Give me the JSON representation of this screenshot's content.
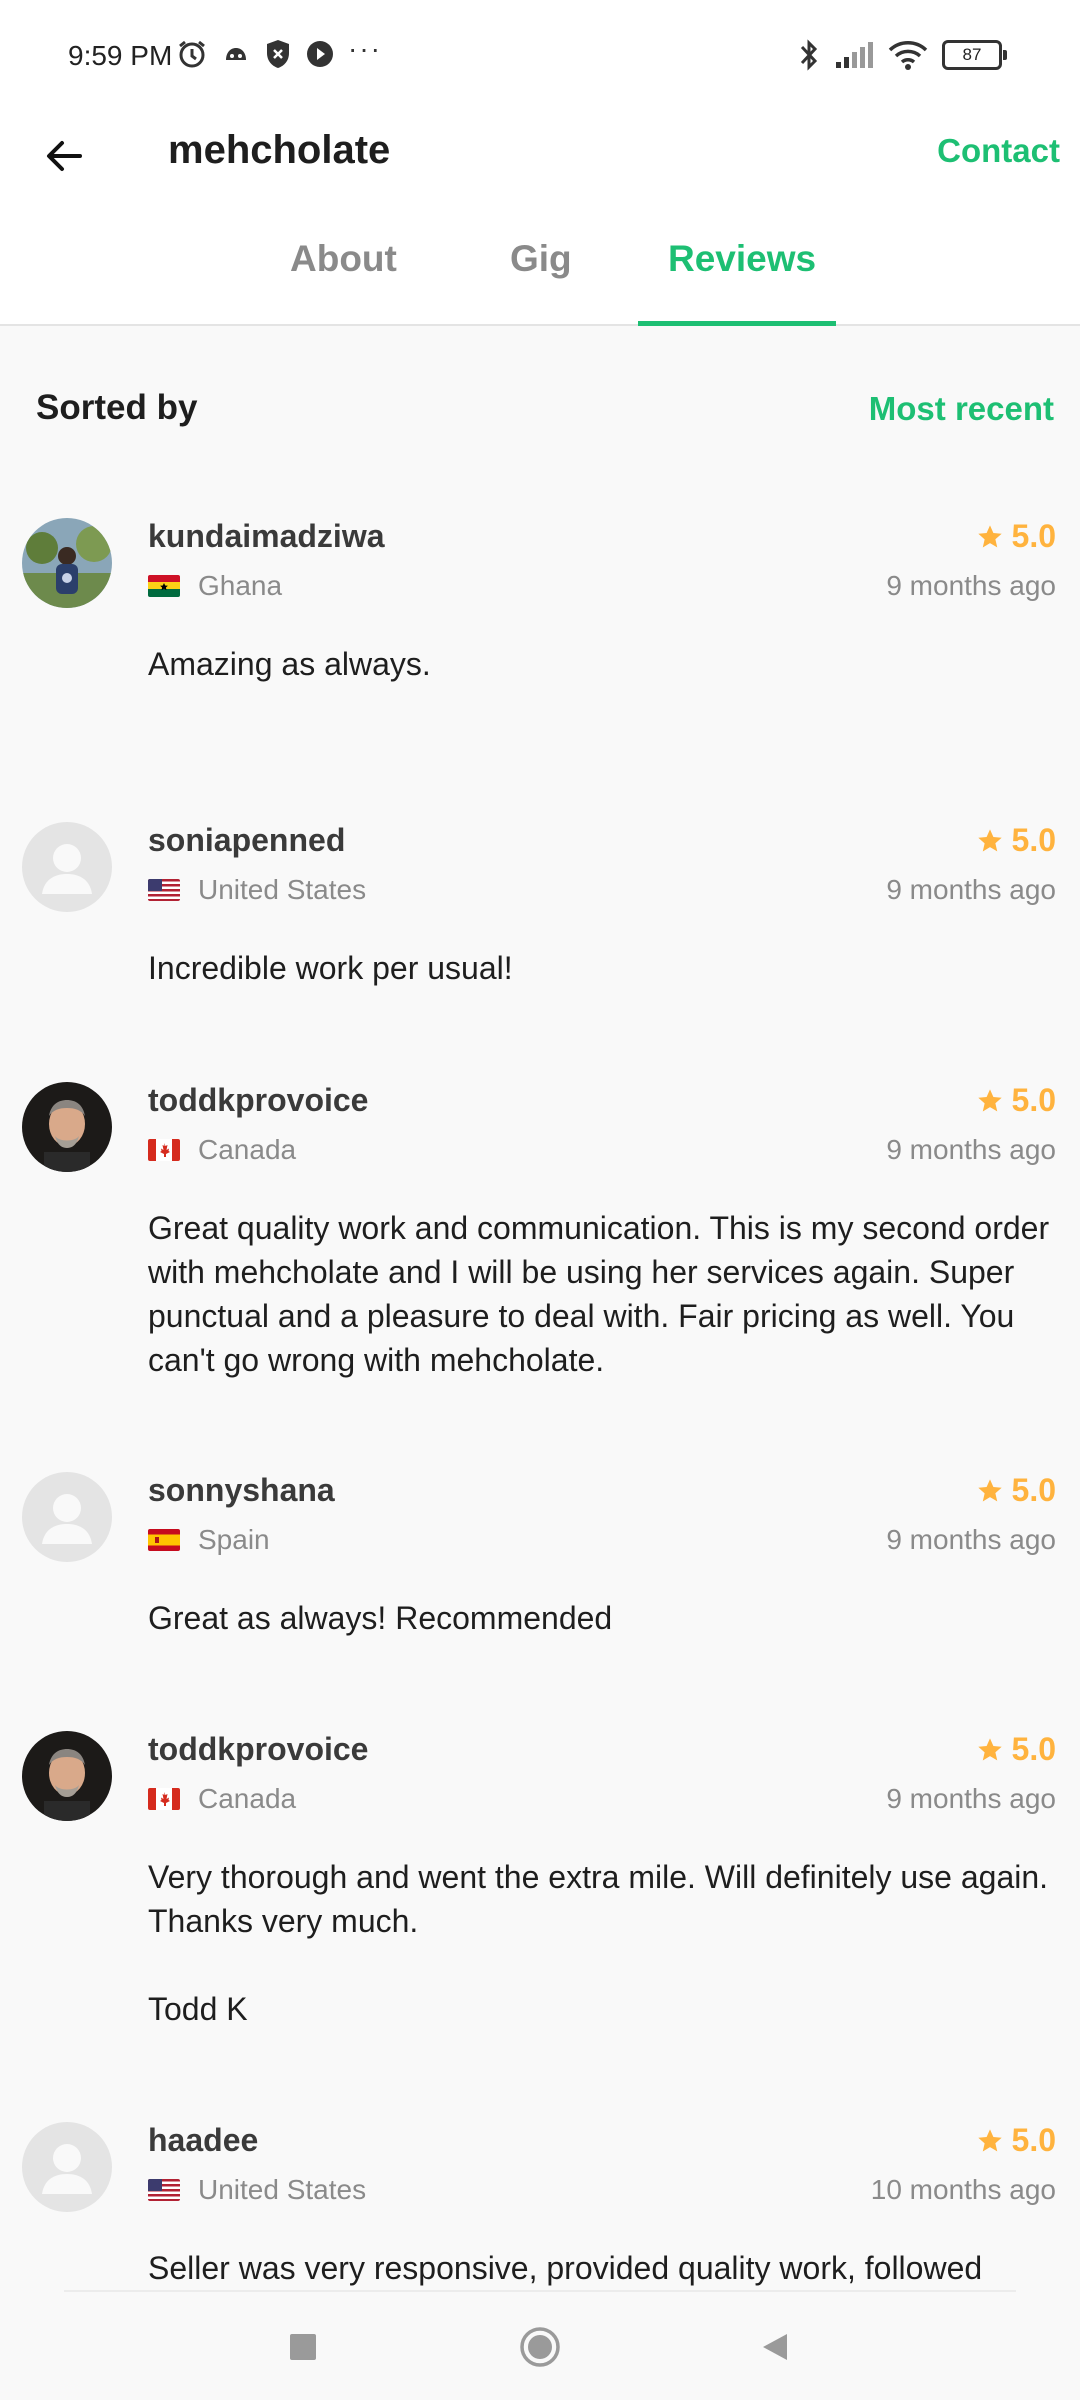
{
  "status_bar": {
    "time": "9:59 PM",
    "dots": "···",
    "battery": "87"
  },
  "header": {
    "title": "mehcholate",
    "contact_label": "Contact"
  },
  "tabs": [
    {
      "label": "About"
    },
    {
      "label": "Gig"
    },
    {
      "label": "Reviews"
    }
  ],
  "sort": {
    "label": "Sorted by",
    "value": "Most recent"
  },
  "reviews": [
    {
      "name": "kundaimadziwa",
      "country": "Ghana",
      "rating": "5.0",
      "time": "9 months ago",
      "text": "Amazing as always."
    },
    {
      "name": "soniapenned",
      "country": "United States",
      "rating": "5.0",
      "time": "9 months ago",
      "text": "Incredible work per usual!"
    },
    {
      "name": "toddkprovoice",
      "country": "Canada",
      "rating": "5.0",
      "time": "9 months ago",
      "text": "Great quality work and communication. This is my second order with mehcholate and I will be using her services again. Super punctual and a pleasure to deal with. Fair pricing as well. You can't go wrong with mehcholate."
    },
    {
      "name": "sonnyshana",
      "country": "Spain",
      "rating": "5.0",
      "time": "9 months ago",
      "text": "Great as always! Recommended"
    },
    {
      "name": "toddkprovoice",
      "country": "Canada",
      "rating": "5.0",
      "time": "9 months ago",
      "text": "Very thorough and went the extra mile. Will definitely use again. Thanks very much.\n\nTodd K"
    },
    {
      "name": "haadee",
      "country": "United States",
      "rating": "5.0",
      "time": "10 months ago",
      "text": "Seller was very responsive, provided quality work, followed"
    }
  ],
  "colors": {
    "accent": "#1dbf73",
    "star": "#ffb33e"
  },
  "icons": {
    "back": "arrow-left-icon",
    "star": "star-icon",
    "avatar_placeholder": "person-icon"
  }
}
